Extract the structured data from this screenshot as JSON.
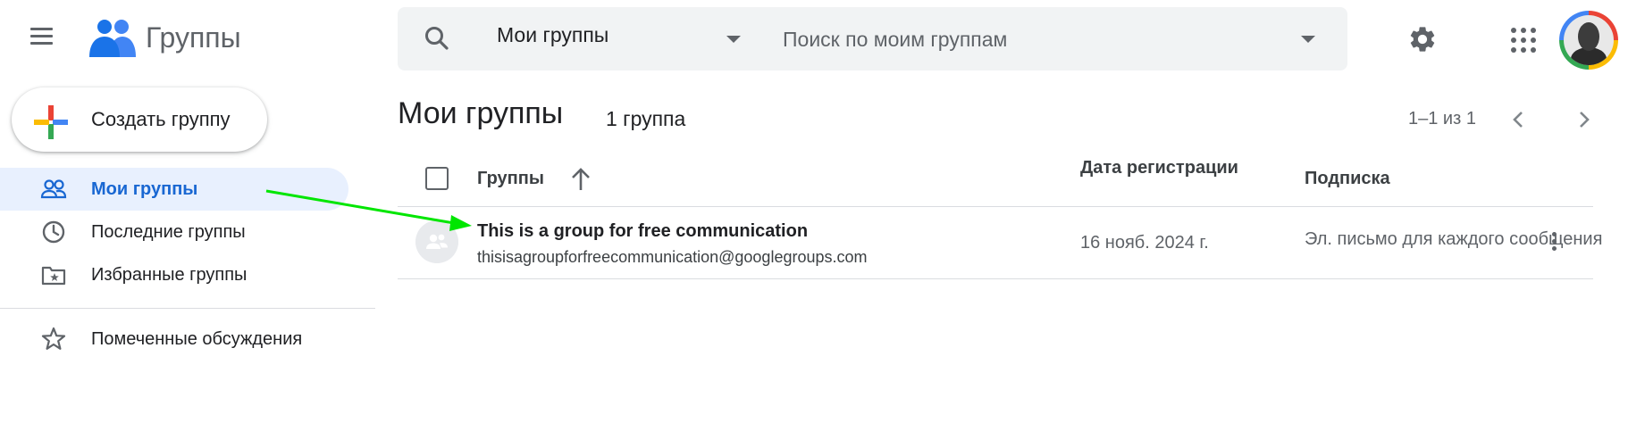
{
  "header": {
    "app_title": "Группы",
    "search_scope": "Мои группы",
    "search_placeholder": "Поиск по моим группам",
    "icons": [
      "menu-icon",
      "groups-logo-icon",
      "search-icon",
      "gear-icon",
      "apps-icon",
      "avatar"
    ]
  },
  "sidebar": {
    "create_label": "Создать группу",
    "items": [
      {
        "label": "Мои группы",
        "icon": "people-icon",
        "active": true
      },
      {
        "label": "Последние группы",
        "icon": "clock-icon",
        "active": false
      },
      {
        "label": "Избранные группы",
        "icon": "starred-folder-icon",
        "active": false
      },
      {
        "label": "Помеченные обсуждения",
        "icon": "star-icon",
        "active": false
      }
    ]
  },
  "main": {
    "title": "Мои группы",
    "count": "1 группа",
    "pagination": "1–1 из 1",
    "columns": {
      "groups": "Группы",
      "date": "Дата регистрации",
      "subscription": "Подписка"
    },
    "rows": [
      {
        "name": "This is a group for free communication",
        "email": "thisisagroupforfreecommunication@googlegroups.com",
        "date": "16 нояб. 2024 г.",
        "subscription": "Эл. письмо для каждого сообщения"
      }
    ]
  },
  "colors": {
    "accent": "#1967d2",
    "active_bg": "#e8f0fe",
    "annotation_arrow": "#00e600"
  }
}
